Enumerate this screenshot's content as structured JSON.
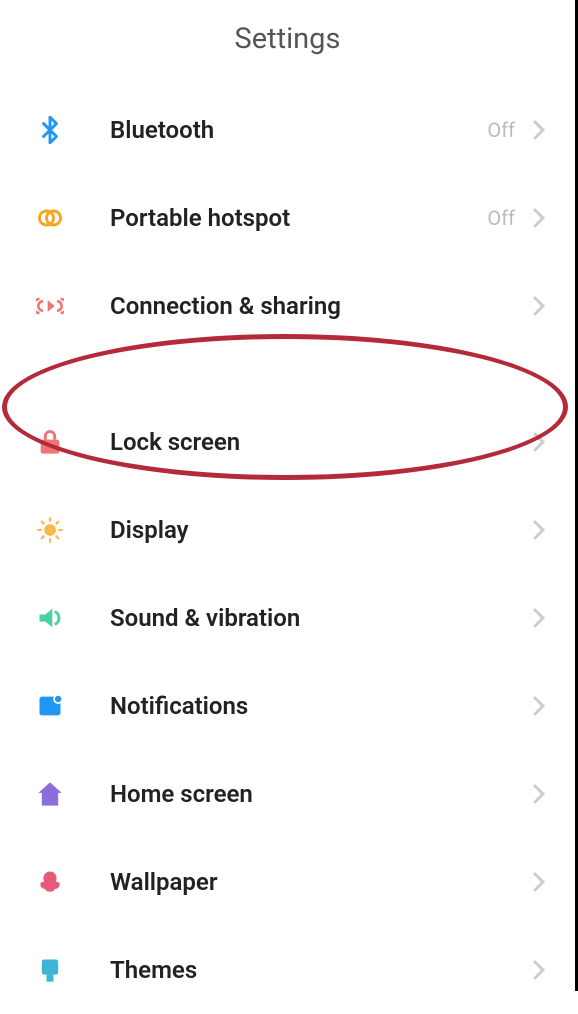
{
  "header": {
    "title": "Settings"
  },
  "items": {
    "bluetooth": {
      "label": "Bluetooth",
      "value": "Off"
    },
    "hotspot": {
      "label": "Portable hotspot",
      "value": "Off"
    },
    "connection": {
      "label": "Connection & sharing"
    },
    "lockscreen": {
      "label": "Lock screen"
    },
    "display": {
      "label": "Display"
    },
    "sound": {
      "label": "Sound & vibration"
    },
    "notifications": {
      "label": "Notifications"
    },
    "homescreen": {
      "label": "Home screen"
    },
    "wallpaper": {
      "label": "Wallpaper"
    },
    "themes": {
      "label": "Themes"
    }
  }
}
